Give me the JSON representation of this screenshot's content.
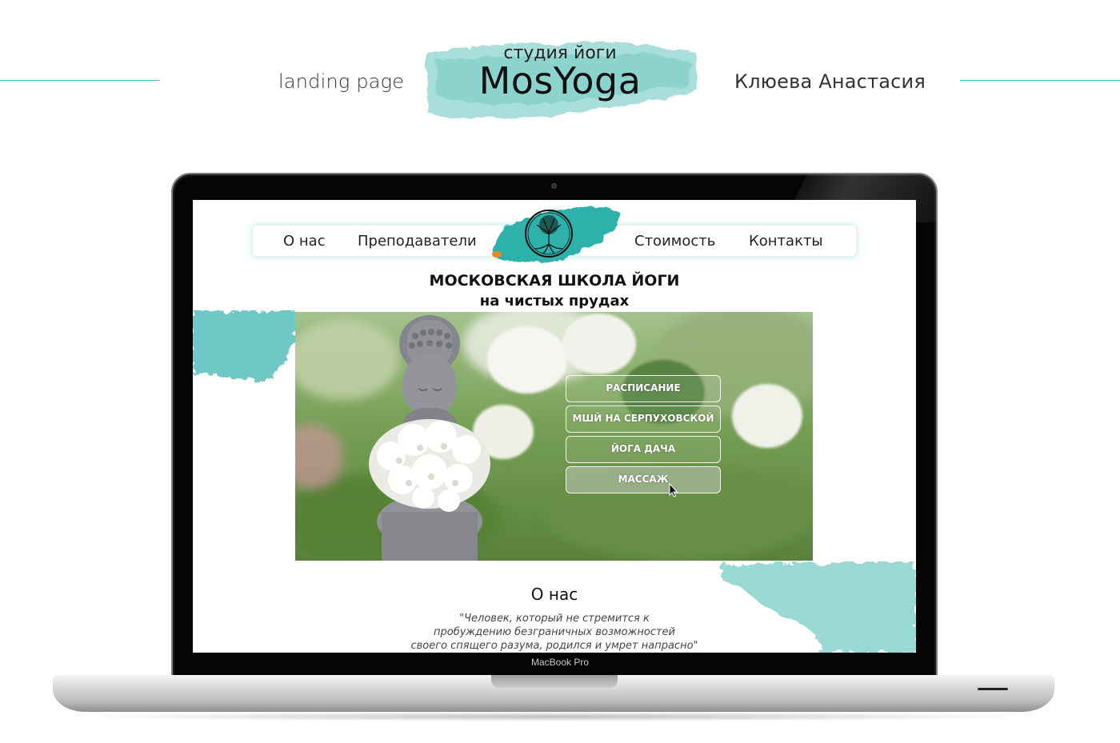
{
  "presentation": {
    "left_caption": "landing page",
    "right_caption": "Клюева Анастасия",
    "studio_label": "студия йоги",
    "brand": "MosYoga",
    "accent": "#4fc3c4"
  },
  "device": {
    "label": "MacBook Pro"
  },
  "site": {
    "nav": {
      "about": "О нас",
      "teachers": "Преподаватели",
      "price": "Стоимость",
      "contacts": "Контакты",
      "logo_icon": "tree-of-life-icon"
    },
    "heading": {
      "title": "МОСКОВСКАЯ ШКОЛА ЙОГИ",
      "subtitle": "на чистых прудах"
    },
    "hero": {
      "image": "buddha-statue-with-white-flowers",
      "buttons": [
        {
          "label": "РАСПИСАНИЕ"
        },
        {
          "label": "МШЙ НА СЕРПУХОВСКОЙ"
        },
        {
          "label": "ЙОГА ДАЧА"
        },
        {
          "label": "МАССАЖ",
          "hovered": true
        }
      ]
    },
    "about": {
      "title": "О нас",
      "quote_lines": [
        "\"Человек, который не стремится к",
        "пробуждению безграничных возможностей",
        "своего спящего разума, родился и умрет напрасно\""
      ]
    },
    "colors": {
      "teal_wash": "#5cc4c0",
      "text": "#111111"
    }
  }
}
